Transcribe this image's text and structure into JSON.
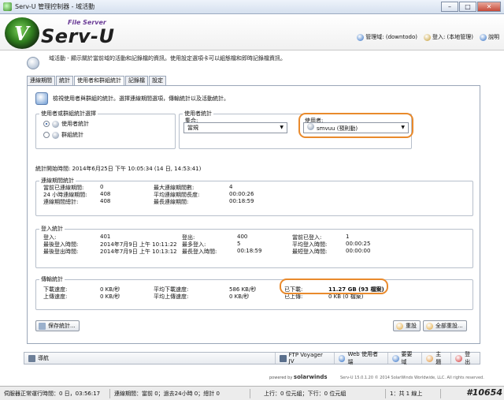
{
  "window": {
    "title": "Serv-U 管理控制器 - 域活動",
    "min": "–",
    "max": "□",
    "close": "✕"
  },
  "brand": {
    "file_server": "File Server",
    "name": "Serv-U",
    "mark": "V"
  },
  "toplinks": {
    "domain": "管理域: (downtodo)",
    "login": "登入: (本地管理)",
    "help": "說明"
  },
  "page": {
    "description": "域活動 - 顯示關於當前域的活動和記錄檔的資訊。使用設定選項卡可以組態檔和即時記錄檔資訊。"
  },
  "tabs": [
    "連線期間",
    "統計",
    "使用者和群組統計",
    "記錄檔",
    "設定"
  ],
  "intro_text": "檢視使用者與群組的統計。選擇連線期間選項，傳輸統計以及活動統計。",
  "stat_type": {
    "legend": "使用者或群組統計選擇",
    "options": [
      {
        "label": "使用者統計",
        "selected": true
      },
      {
        "label": "群組統計",
        "selected": false
      }
    ]
  },
  "user_stats": {
    "legend": "使用者統計",
    "collection_label": "集合:",
    "collection_value": "當規",
    "user_label": "使用者:",
    "user_value": "smvuu (預則動)"
  },
  "stats_start": "統計開始時間: 2014年6月25日 下午 10:05:34 (14 日, 14:53:41)",
  "session_stats": {
    "legend": "連線期間統計",
    "rows": [
      [
        "當前已連線期間:",
        "0",
        "最大連線期間數:",
        "4"
      ],
      [
        "24 小時連線期間:",
        "408",
        "平均連線期間長度:",
        "00:00:26"
      ],
      [
        "連線期間總計:",
        "408",
        "最長連線期間:",
        "00:18:59"
      ]
    ]
  },
  "login_stats": {
    "legend": "登入統計",
    "rows": [
      [
        "登入:",
        "401",
        "登出:",
        "400",
        "當前已登入:",
        "1"
      ],
      [
        "最後登入時間:",
        "2014年7月9日 上午 10:11:22",
        "最多登入:",
        "5",
        "平均登入時間:",
        "00:00:25"
      ],
      [
        "最後登出時間:",
        "2014年7月9日 上午 10:13:12",
        "最長登入時間:",
        "00:18:59",
        "最短登入時間:",
        "00:00:00"
      ]
    ]
  },
  "transfer_stats": {
    "legend": "傳輸統計",
    "rows": [
      [
        "下載速度:",
        "0 KB/秒",
        "平均下載速度:",
        "586 KB/秒",
        "已下載:",
        "11.27 GB (93 檔案)"
      ],
      [
        "上傳速度:",
        "0 KB/秒",
        "平均上傳速度:",
        "0 KB/秒",
        "已上傳:",
        "0 KB (0 檔案)"
      ]
    ]
  },
  "buttons": {
    "save_stats": "保存統計...",
    "reset": "重設",
    "reset_all": "全部重設..."
  },
  "nav": {
    "nav_label": "導航",
    "ftp_voyager": "FTP Voyager JV",
    "web_client": "Web 使用者端",
    "manage": "要要域",
    "theme": "主題",
    "logout": "登出"
  },
  "powered": {
    "prefix": "powered by",
    "brand": "solarwinds",
    "suffix": "Serv-U"
  },
  "copyright": "Serv-U 15.0.1.20 © 2014 SolarWinds Worldwide, LLC. All rights reserved.",
  "statusbar": [
    "伺服器正常運行時間：0 日，03:56:17",
    "連線期間：當前 0；過去24小時 0；總計 0",
    "上行：0 位元組；下行：0 位元組",
    "1：共 1 線上"
  ],
  "watermark": "#10654"
}
